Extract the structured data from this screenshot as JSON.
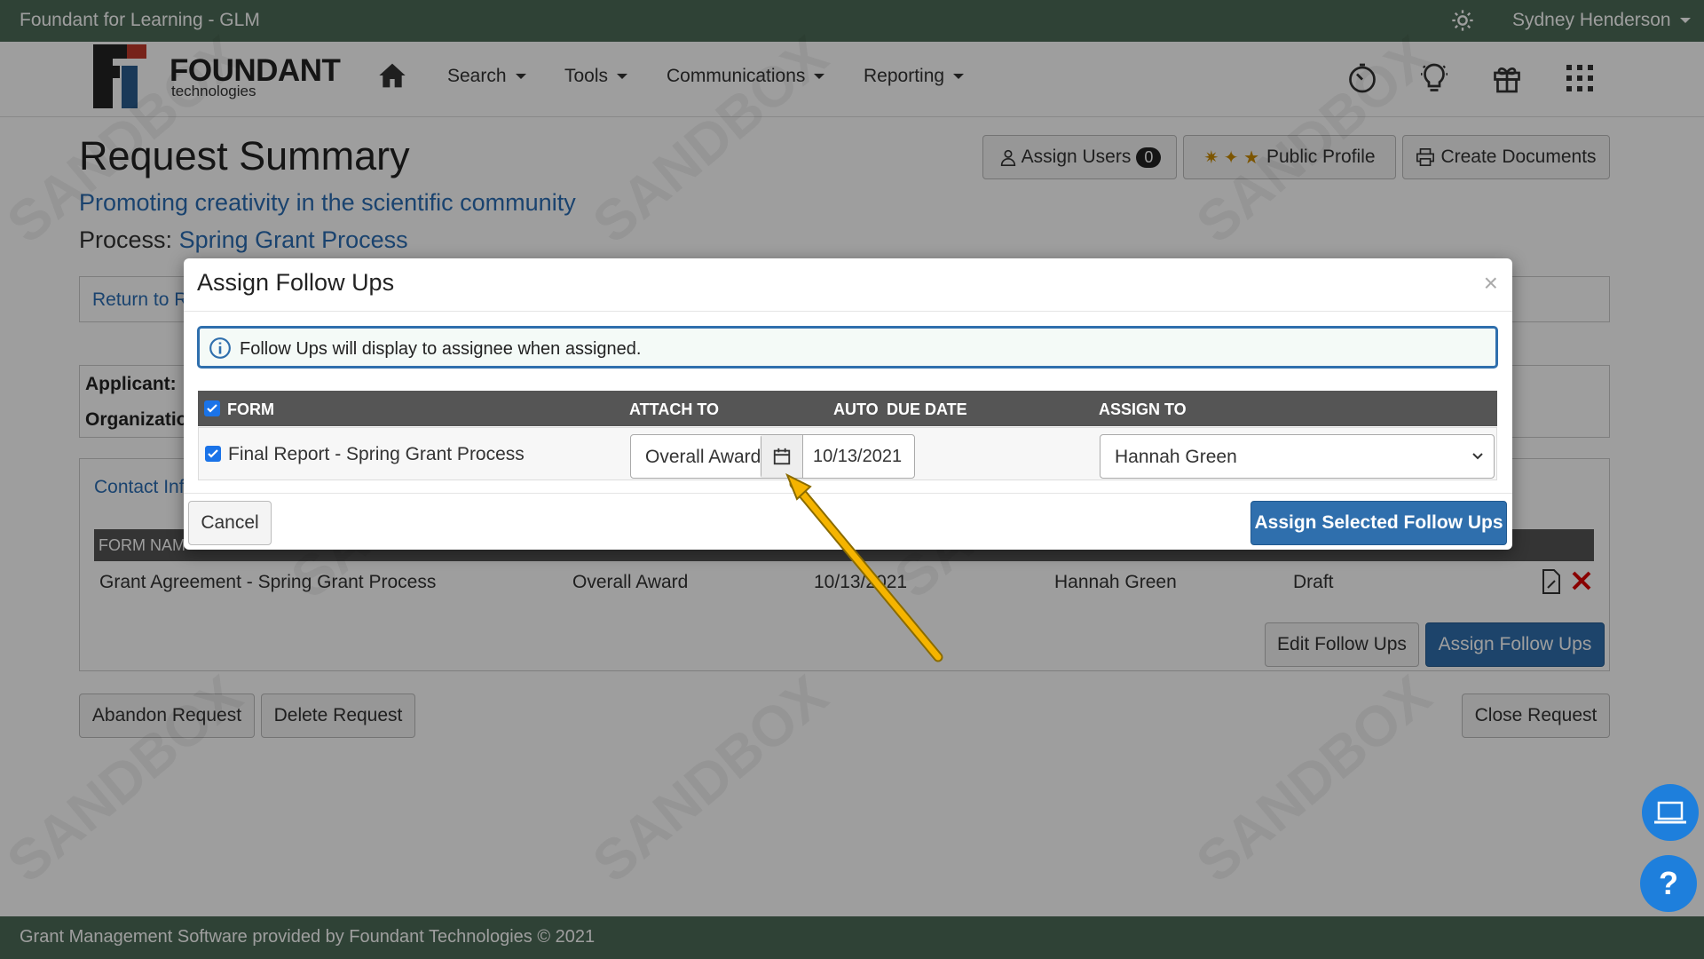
{
  "topbar": {
    "app_title": "Foundant for Learning - GLM",
    "user_name": "Sydney Henderson"
  },
  "logo": {
    "wordmark": "FOUNDANT",
    "sub": "technologies"
  },
  "nav": {
    "search": "Search",
    "tools": "Tools",
    "communications": "Communications",
    "reporting": "Reporting"
  },
  "page": {
    "title": "Request Summary",
    "subtitle": "Promoting creativity in the scientific community",
    "process_label": "Process:",
    "process_name": "Spring Grant Process",
    "return_link": "Return to R",
    "applicant_label": "Applicant:",
    "organization_label": "Organizatio",
    "contact_tab": "Contact Inf"
  },
  "header_buttons": {
    "assign_users": "Assign Users",
    "assign_users_count": "0",
    "public_profile": "Public Profile",
    "create_documents": "Create Documents"
  },
  "followups_table": {
    "col_form_name": "FORM NAM",
    "row": {
      "form": "Grant Agreement - Spring Grant Process",
      "attach_to": "Overall Award",
      "due_date": "10/13/2021",
      "assign_to": "Hannah Green",
      "status": "Draft"
    }
  },
  "page_buttons": {
    "edit_follow_ups": "Edit Follow Ups",
    "assign_follow_ups": "Assign Follow Ups",
    "abandon_request": "Abandon Request",
    "delete_request": "Delete Request",
    "close_request": "Close Request"
  },
  "footer": {
    "text": "Grant Management Software provided by Foundant Technologies © 2021"
  },
  "help": {
    "question_mark": "?"
  },
  "watermark": "SANDBOX",
  "modal": {
    "title": "Assign Follow Ups",
    "close": "×",
    "alert": "Follow Ups will display to assignee when assigned.",
    "columns": {
      "form": "FORM",
      "attach_to": "ATTACH TO",
      "auto": "AUTO",
      "due_date": "DUE DATE",
      "assign_to": "ASSIGN TO"
    },
    "row": {
      "form": "Final Report - Spring Grant Process",
      "attach_to": "Overall Award",
      "due_date": "10/13/2021",
      "assign_to": "Hannah Green"
    },
    "cancel": "Cancel",
    "assign_selected": "Assign Selected Follow Ups"
  },
  "colors": {
    "header_green": "#4d6b57",
    "primary_blue": "#2f6fad",
    "link_blue": "#2a6db3",
    "annotation_arrow": "#f5b400"
  }
}
